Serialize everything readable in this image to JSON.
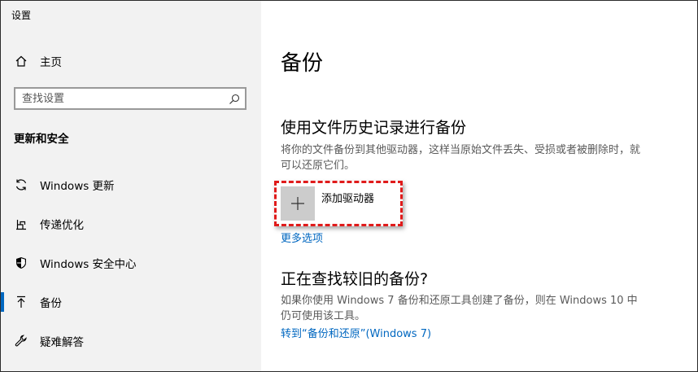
{
  "window": {
    "title": "设置"
  },
  "sidebar": {
    "home_label": "主页",
    "search_placeholder": "查找设置",
    "section_title": "更新和安全",
    "items": [
      {
        "label": "Windows 更新",
        "icon": "sync-icon"
      },
      {
        "label": "传递优化",
        "icon": "delivery-optimization-icon"
      },
      {
        "label": "Windows 安全中心",
        "icon": "shield-icon"
      },
      {
        "label": "备份",
        "icon": "backup-arrow-icon",
        "selected": true
      },
      {
        "label": "疑难解答",
        "icon": "wrench-icon"
      }
    ]
  },
  "main": {
    "title": "备份",
    "file_history": {
      "heading": "使用文件历史记录进行备份",
      "description": "将你的文件备份到其他驱动器，这样当原始文件丢失、受损或者被删除时，就可以还原它们。",
      "add_drive_label": "添加驱动器",
      "more_options_link": "更多选项"
    },
    "older_backup": {
      "heading": "正在查找较旧的备份?",
      "description": "如果你使用 Windows 7 备份和还原工具创建了备份，则在 Windows 10 中仍可使用该工具。",
      "link": "转到“备份和还原”(Windows 7)"
    }
  },
  "colors": {
    "accent": "#0067c0",
    "highlight_border": "#e01b1b",
    "sidebar_bg": "#f2f2f2"
  }
}
